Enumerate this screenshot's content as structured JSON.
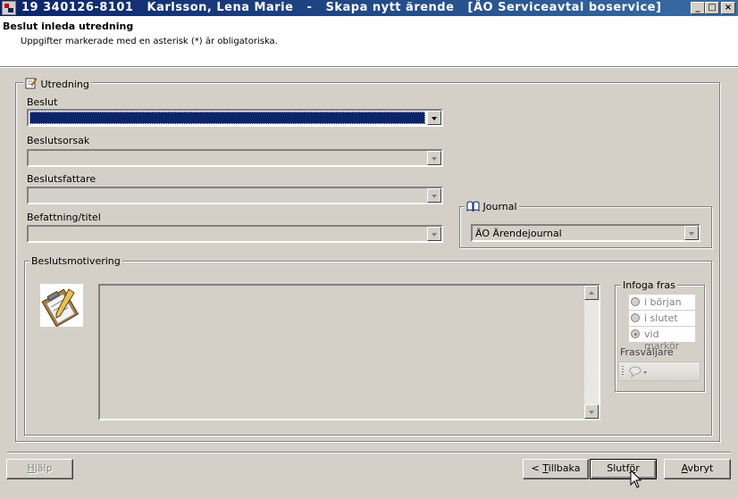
{
  "window": {
    "title": "19 340126-8101   Karlsson, Lena Marie   -   Skapa nytt ärende   [ÄO Serviceavtal boservice]",
    "app_icon": "app-icon",
    "controls": [
      "minimize-icon",
      "maximize-icon",
      "close-icon"
    ]
  },
  "header": {
    "title": "Beslut inleda utredning",
    "subtitle": "Uppgifter markerade med en asterisk (*) är obligatoriska."
  },
  "utredning": {
    "legend": "Utredning",
    "icon": "edit-document-icon",
    "beslut": {
      "label": "Beslut",
      "value": ""
    },
    "beslutsorsak": {
      "label": "Beslutsorsak",
      "value": ""
    },
    "beslutsfattare": {
      "label": "Beslutsfattare",
      "value": ""
    },
    "befattning": {
      "label": "Befattning/titel",
      "value": ""
    },
    "journal": {
      "legend": "Journal",
      "icon": "book-icon",
      "value": "ÄO Ärendejournal"
    },
    "beslutsmotivering": {
      "legend": "Beslutsmotivering",
      "icon": "clipboard-pen-icon",
      "text": "",
      "infoga_fras": {
        "legend": "Infoga fras",
        "options": [
          "i början",
          "i slutet",
          "vid markör"
        ],
        "selected": "vid markör"
      },
      "frasvaljare": {
        "label": "Frasväljare",
        "icon": "speech-bubble-icon"
      }
    }
  },
  "footer": {
    "help": {
      "prefix": "",
      "accel": "H",
      "rest": "jälp"
    },
    "back": {
      "prefix": "< ",
      "accel": "T",
      "rest": "illbaka"
    },
    "finish": {
      "prefix": "Slutf",
      "accel": "ö",
      "rest": "r"
    },
    "cancel": {
      "prefix": "",
      "accel": "A",
      "rest": "vbryt"
    }
  },
  "colors": {
    "titlebar_start": "#0a246a",
    "titlebar_end": "#3a6ea5",
    "face": "#d4d0c8",
    "selection": "#0a246a"
  }
}
